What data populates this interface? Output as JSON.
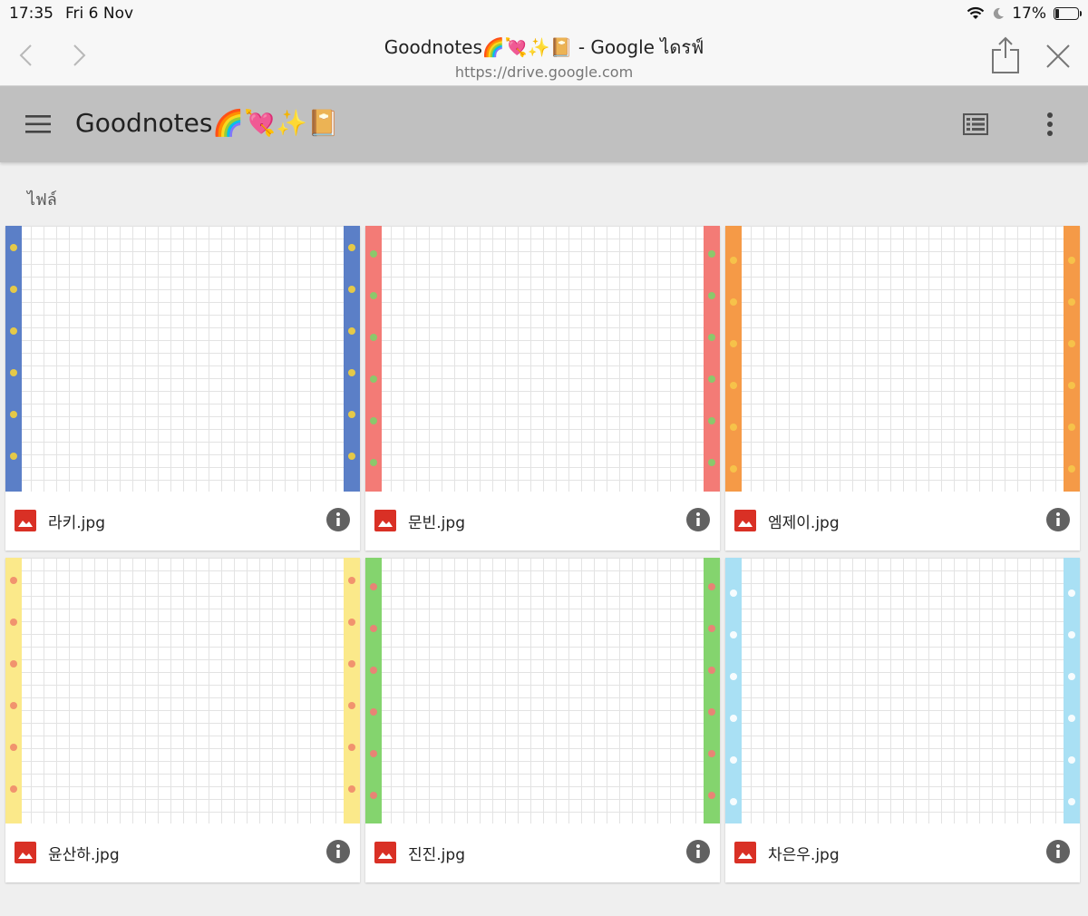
{
  "status": {
    "time": "17:35",
    "date": "Fri 6 Nov",
    "battery": "17%",
    "battery_level": 0.17
  },
  "browser": {
    "title": "Goodnotes🌈💘✨📔 - Google ไดรฟ์",
    "url": "https://drive.google.com",
    "icons": [
      "back-icon",
      "forward-icon",
      "share-icon",
      "close-icon"
    ]
  },
  "drive": {
    "folder_title": "Goodnotes🌈💘✨📔",
    "section_label": "ไฟล์",
    "icons": [
      "menu-icon",
      "list-view-icon",
      "more-options-icon"
    ]
  },
  "files": [
    {
      "name": "라키.jpg",
      "strip_color": "#5b7fc7",
      "accent": "#f4d23a"
    },
    {
      "name": "문빈.jpg",
      "strip_color": "#f37b76",
      "accent": "#7fd06a"
    },
    {
      "name": "엠제이.jpg",
      "strip_color": "#f59a47",
      "accent": "#f6c64a"
    },
    {
      "name": "윤산하.jpg",
      "strip_color": "#fbe98a",
      "accent": "#f08a6a"
    },
    {
      "name": "진진.jpg",
      "strip_color": "#84d46e",
      "accent": "#f37b76"
    },
    {
      "name": "차은우.jpg",
      "strip_color": "#a9e0f4",
      "accent": "#ffffff"
    }
  ],
  "colors": {
    "header_bg": "#c0c0c0",
    "page_bg": "#efefef",
    "image_icon": "#d93025",
    "info_icon": "#616161"
  }
}
